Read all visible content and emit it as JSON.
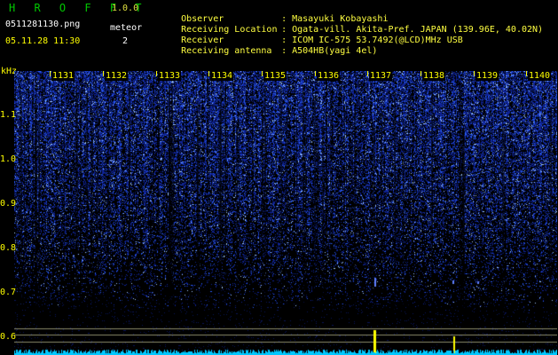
{
  "header": {
    "app_name": "H R O F F T",
    "app_version": "1.0.0",
    "file_name": "0511281130.png",
    "datetime": "05.11.28 11:30",
    "meteor_label": "meteor",
    "meteor_count": "2"
  },
  "info": [
    {
      "key": "Observer",
      "sep": ":",
      "value": "Masayuki Kobayashi"
    },
    {
      "key": "Receiving Location",
      "sep": ":",
      "value": "Ogata-vill. Akita-Pref. JAPAN (139.96E, 40.02N)"
    },
    {
      "key": "Receiver",
      "sep": ":",
      "value": "ICOM IC-575 53.7492(@LCD)MHz USB"
    },
    {
      "key": "Receiving antenna",
      "sep": ":",
      "value": "A504HB(yagi 4el)"
    }
  ],
  "axes": {
    "y_unit": "kHz",
    "y_ticks": [
      "1.1",
      "1.0",
      "0.9",
      "0.8",
      "0.7",
      "0.6"
    ],
    "x_ticks": [
      "1131",
      "1132",
      "1133",
      "1134",
      "1135",
      "1136",
      "1137",
      "1138",
      "1139",
      "1140"
    ]
  },
  "colors": {
    "background": "#000000",
    "label": "#ffff00",
    "app_name": "#00c800",
    "signal_low": "#0a1e8c",
    "signal_high": "#3c8cff",
    "meteor": "#ffff00",
    "baseline": "#00c8ff"
  }
}
